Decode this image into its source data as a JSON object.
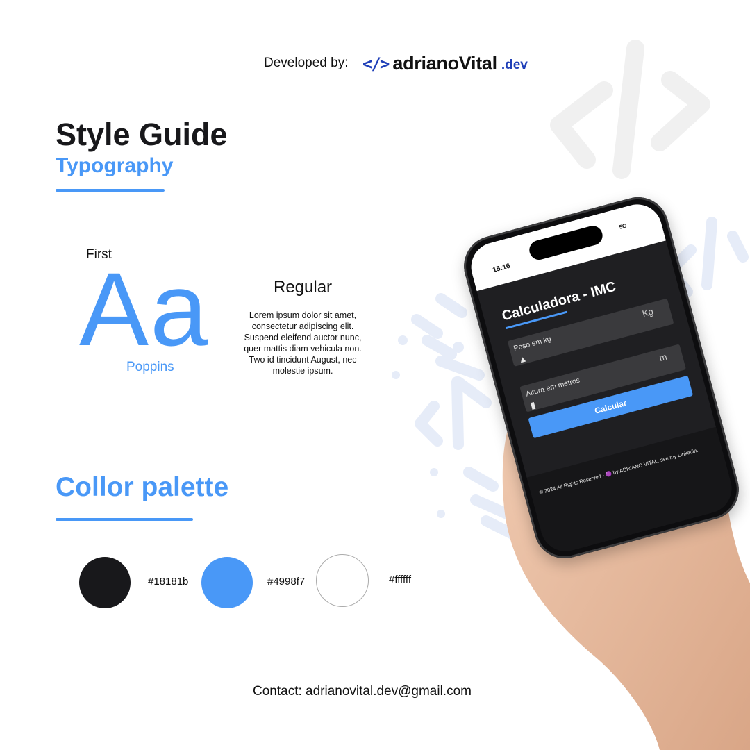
{
  "header": {
    "developed_by": "Developed by:",
    "brand_icon": "</>",
    "brand_name": "adrianoVital",
    "brand_tld": ".dev"
  },
  "style_guide": {
    "title": "Style Guide",
    "subtitle": "Typography"
  },
  "typography": {
    "first_label": "First",
    "sample": "Aa",
    "font_name": "Poppins",
    "weight": "Regular",
    "lorem": "Lorem ipsum dolor sit amet, consectetur adipiscing elit. Suspend eleifend auctor nunc, quer mattis diam vehicula non. Two id tincidunt August, nec molestie ipsum."
  },
  "palette": {
    "title": "Collor palette",
    "colors": [
      {
        "hex_label": "#18181b",
        "color": "#18181b"
      },
      {
        "hex_label": "#4998f7",
        "color": "#4998f7"
      },
      {
        "hex_label": "#ffffff",
        "color": "#ffffff"
      }
    ]
  },
  "phone": {
    "status_time": "15:16",
    "status_signal": "5G",
    "app_title": "Calculadora - IMC",
    "weight_label": "Peso em kg",
    "weight_unit": "Kg",
    "height_label": "Altura em metros",
    "height_unit": "m",
    "button_label": "Calcular",
    "footer": "© 2024 All Rights Reserved - 🟣 by ADRIANO VITAL, see my Linkedin."
  },
  "contact": "Contact: adrianovital.dev@gmail.com",
  "colors": {
    "dark": "#18181b",
    "accent": "#4998f7",
    "white": "#ffffff",
    "brand_blue": "#1f3fb8"
  },
  "icons": {
    "weight_icon": "weight-icon",
    "ruler_icon": "ruler-icon",
    "code_mark": "code-brackets-icon"
  }
}
